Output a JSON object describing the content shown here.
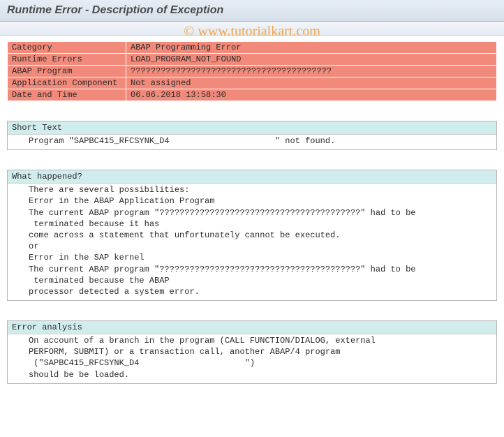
{
  "title": "Runtime Error - Description of Exception",
  "watermark": "© www.tutorialkart.com",
  "info": {
    "rows": [
      {
        "label": "Category",
        "value": "ABAP Programming Error"
      },
      {
        "label": "Runtime Errors",
        "value": "LOAD_PROGRAM_NOT_FOUND"
      },
      {
        "label": "ABAP Program",
        "value": "????????????????????????????????????????"
      },
      {
        "label": "Application Component",
        "value": "Not assigned"
      },
      {
        "label": "Date and Time",
        "value": "06.06.2018 13:58:30"
      }
    ]
  },
  "sections": {
    "short_text": {
      "header": "Short Text",
      "lines": [
        "Program \"SAPBC415_RFCSYNK_D4                     \" not found."
      ]
    },
    "what_happened": {
      "header": "What happened?",
      "lines": [
        "There are several possibilities:",
        "Error in the ABAP Application Program",
        "",
        "The current ABAP program \"????????????????????????????????????????\" had to be",
        " terminated because it has",
        "come across a statement that unfortunately cannot be executed.",
        "or",
        "Error in the SAP kernel",
        "",
        "The current ABAP program \"????????????????????????????????????????\" had to be",
        " terminated because the ABAP",
        "processor detected a system error."
      ]
    },
    "error_analysis": {
      "header": "Error analysis",
      "lines": [
        "On account of a branch in the program (CALL FUNCTION/DIALOG, external",
        "PERFORM, SUBMIT) or a transaction call, another ABAP/4 program",
        " (\"SAPBC415_RFCSYNK_D4                     \")",
        "should be be loaded."
      ]
    }
  }
}
